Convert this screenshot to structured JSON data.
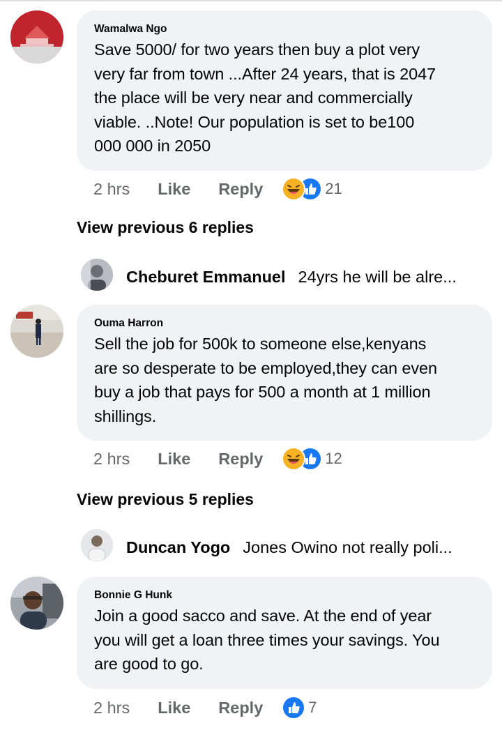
{
  "comments": [
    {
      "author": "Wamalwa Ngo",
      "text_lines": [
        "Save 5000/ for two years then buy a plot very",
        "very far from town ...After 24 years, that is 2047",
        "the place will be very near and commercially",
        "viable. ..Note! Our population is set to be100",
        "000 000 in 2050"
      ],
      "time": "2 hrs",
      "like_label": "Like",
      "reply_label": "Reply",
      "reaction_count": "21",
      "view_previous": "View previous 6 replies",
      "reply_preview": {
        "name": "Cheburet Emmanuel",
        "snippet": "24yrs he will be alre..."
      }
    },
    {
      "author": "Ouma Harron",
      "text_lines": [
        "Sell the job for 500k to someone else,kenyans",
        "are so desperate to be employed,they can even",
        "buy a job that pays for 500 a month at 1 million",
        "shillings."
      ],
      "time": "2 hrs",
      "like_label": "Like",
      "reply_label": "Reply",
      "reaction_count": "12",
      "view_previous": "View previous 5 replies",
      "reply_preview": {
        "name": "Duncan Yogo",
        "snippet": "Jones Owino not really poli..."
      }
    },
    {
      "author": "Bonnie G Hunk",
      "text_lines": [
        "Join a good sacco and save. At the end of year",
        "you will get a loan three times your savings. You",
        "are good to go."
      ],
      "time": "2 hrs",
      "like_label": "Like",
      "reply_label": "Reply",
      "reaction_count": "7"
    }
  ],
  "colors": {
    "bubble_bg": "#f0f2f5",
    "meta_text": "#65676b",
    "like_blue": "#1877f2",
    "haha_yellow": "#f7b125"
  },
  "icons": {
    "haha": "haha-reaction-icon",
    "like": "like-reaction-icon"
  }
}
